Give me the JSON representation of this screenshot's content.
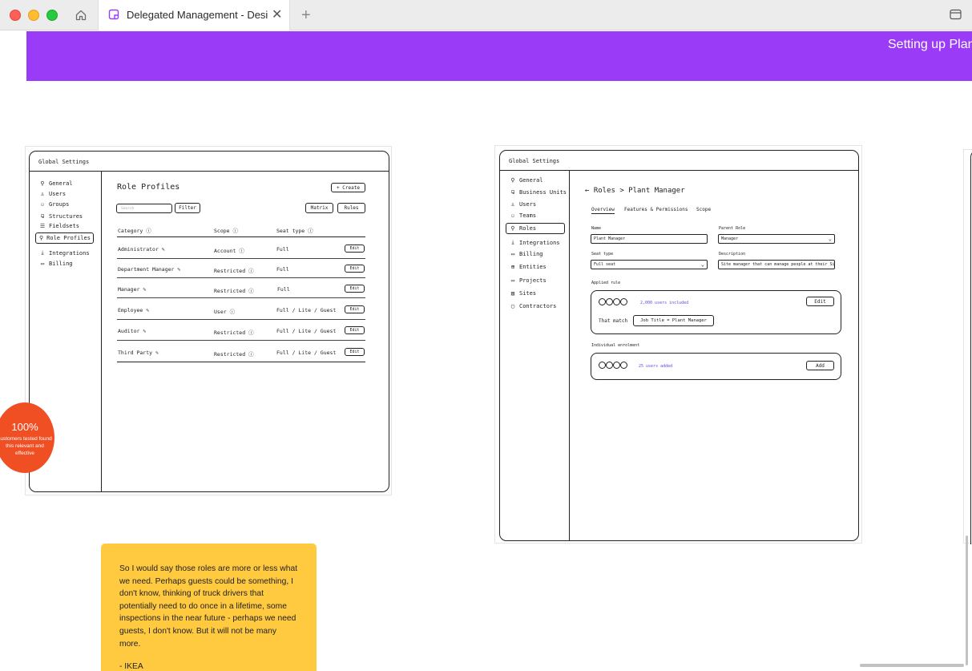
{
  "browser": {
    "tab_title": "Delegated Management - Design",
    "new_tab": "+",
    "close": "✕"
  },
  "banner": {
    "text": "Setting up Plan",
    "color": "#9a3cf7"
  },
  "role_profiles_frame": {
    "header": "Global Settings",
    "nav": [
      "General",
      "Users",
      "Groups",
      "Structures",
      "Fieldsets",
      "Role Profiles",
      "Integrations",
      "Billing"
    ],
    "active_nav": "Role Profiles",
    "title": "Role Profiles",
    "create": "+ Create",
    "search_placeholder": "Search",
    "filter": "Filter",
    "matrix": "Matrix",
    "rules": "Rules",
    "columns": [
      "Category",
      "Scope",
      "Seat type"
    ],
    "edit": "Edit",
    "rows": [
      {
        "category": "Administrator",
        "scope": "Account",
        "seat": "Full"
      },
      {
        "category": "Department Manager",
        "scope": "Restricted",
        "seat": "Full"
      },
      {
        "category": "Manager",
        "scope": "Restricted",
        "seat": "Full"
      },
      {
        "category": "Employee",
        "scope": "User",
        "seat": "Full / Lite / Guest"
      },
      {
        "category": "Auditor",
        "scope": "Restricted",
        "seat": "Full / Lite / Guest"
      },
      {
        "category": "Third Party",
        "scope": "Restricted",
        "seat": "Full / Lite / Guest"
      }
    ]
  },
  "badge": {
    "percent": "100%",
    "text": "customers tested found this relevant and effective",
    "color": "#f04e23"
  },
  "role_detail_frame": {
    "header": "Global Settings",
    "nav": [
      "General",
      "Business Units",
      "Users",
      "Teams",
      "Roles",
      "Integrations",
      "Billing",
      "Entities",
      "Projects",
      "Sites",
      "Contractors"
    ],
    "active_nav": "Roles",
    "breadcrumb": "← Roles > Plant Manager",
    "tabs": [
      "Overview",
      "Features & Permissions",
      "Scope"
    ],
    "active_tab": "Overview",
    "name_label": "Name",
    "name_value": "Plant Manager",
    "parent_label": "Parent Role",
    "parent_value": "Manager",
    "seat_label": "Seat type",
    "seat_value": "Full seat",
    "desc_label": "Description",
    "desc_value": "Site manager that can manage people at their Sites",
    "applied_label": "Applied rule",
    "applied_users": "2,000 users included",
    "applied_edit": "Edit",
    "match_label": "That match",
    "match_rule": "Job Title = Plant Manager",
    "individual_label": "Individual enrolment",
    "individual_users": "25 users added",
    "add": "Add"
  },
  "sticky_note": {
    "text": "So I would say those roles are more or less what we need. Perhaps guests could be something, I don't know, thinking of truck drivers that potentially need to do once in a lifetime, some inspections in the near future - perhaps we need guests, I don't know. But it will not be many more.",
    "author": "- IKEA",
    "color": "#ffc940"
  }
}
